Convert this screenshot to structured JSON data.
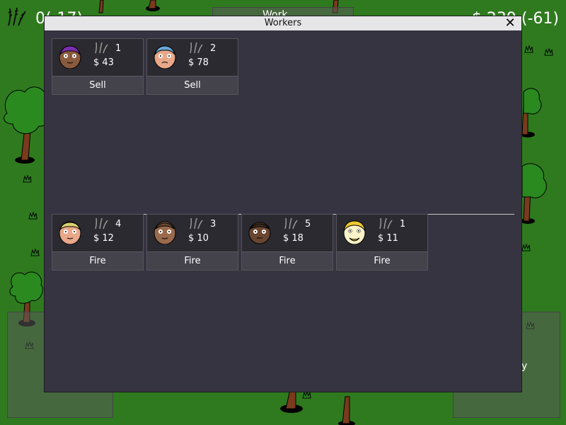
{
  "hud": {
    "left_text": "0(-17)",
    "right_text": "$ 239 (-61)"
  },
  "background": {
    "panel_left_label": "",
    "panel_right_label": "y",
    "top_bar_label": "Work"
  },
  "window": {
    "title": "Workers",
    "close_icon": "close-icon",
    "owned": [
      {
        "face": "dark-purple-hair",
        "count": "1",
        "price": "$ 43",
        "action": "Sell"
      },
      {
        "face": "pale-blue-hair",
        "count": "2",
        "price": "$ 78",
        "action": "Sell"
      }
    ],
    "hired": [
      {
        "face": "light-yellow-hair",
        "count": "4",
        "price": "$ 12",
        "action": "Fire"
      },
      {
        "face": "medium-brown",
        "count": "3",
        "price": "$ 10",
        "action": "Fire"
      },
      {
        "face": "dark-brown",
        "count": "5",
        "price": "$ 18",
        "action": "Fire"
      },
      {
        "face": "blond-beard",
        "count": "1",
        "price": "$ 11",
        "action": "Fire"
      }
    ]
  },
  "colors": {
    "grass": "#2f7a1e",
    "window_bg": "#363440",
    "title_bar": "#e6e6e8",
    "card_bg": "#2a2a30",
    "button_bg": "#44424a"
  }
}
